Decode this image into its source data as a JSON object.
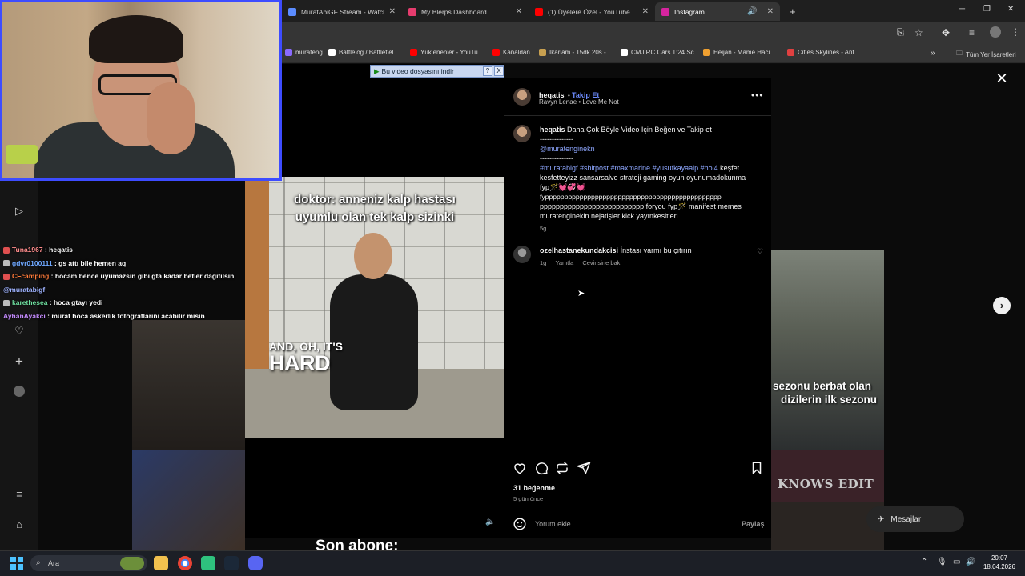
{
  "browser": {
    "tabs": [
      {
        "label": "MuratAbiGF Stream - Watch Liv",
        "color": "#5b8cff"
      },
      {
        "label": "My Blerps Dashboard",
        "color": "#e63c6e"
      },
      {
        "label": "(1) Üyelere Özel - YouTube",
        "color": "#ff0000"
      },
      {
        "label": "Instagram",
        "color": "#d6249f"
      }
    ],
    "bookmarks": [
      {
        "label": "murateng...",
        "color": "#8a6aff"
      },
      {
        "label": "Battlelog / Battlefiel...",
        "color": "#ffffff"
      },
      {
        "label": "Yüklenenler - YouTu...",
        "color": "#ff0000"
      },
      {
        "label": "Kanaldan",
        "color": "#ff0000"
      },
      {
        "label": "Ikariam - 15dk 20s -...",
        "color": "#c8a050"
      },
      {
        "label": "CMJ RC Cars 1:24 Sc...",
        "color": "#ffffff"
      },
      {
        "label": "Heijan - Mame Haci...",
        "color": "#f0a030"
      },
      {
        "label": "Cities Skylines - Ant...",
        "color": "#e04040"
      }
    ],
    "all_bookmarks": "Tüm Yer İşaretleri",
    "new_tab": "+",
    "minimize": "─",
    "maximize": "❐",
    "close": "✕"
  },
  "overlay": {
    "download_bar": "Bu video dosyasını indir",
    "download_help": "?",
    "download_close": "X",
    "chat": [
      {
        "user": "Tuna1967",
        "msg": "heqatis",
        "color": "#ff8c8c"
      },
      {
        "user": "gdvr0100111",
        "msg": "gs attı bile hemen aq",
        "color": "#6fa8ff"
      },
      {
        "user": "CFcamping",
        "msg": "hocam bence uyumazsın gibi gta kadar betler dağıtılsın",
        "color": "#ff7b3a"
      },
      {
        "user": "",
        "msg": "@muratabigf",
        "color": "#9fb3ff"
      },
      {
        "user": "karethesea",
        "msg": "hoca gtayı yedi",
        "color": "#6fe0a0"
      },
      {
        "user": "AyhanAyakci",
        "msg": "murat hoca askerlik fotograflarini acabilir misin",
        "color": "#c58cff"
      }
    ],
    "son_abone": "Son abone:"
  },
  "video": {
    "caption_line1": "doktor: anneniz kalp hastası",
    "caption_line2": "uyumlu olan tek kalp sizinki",
    "caption_small": "AND, OH, IT'S",
    "caption_big": "HARD"
  },
  "post": {
    "username": "heqatis",
    "follow": "Takip Et",
    "audio": "Ravyn Lenae • Love Me Not",
    "caption_user": "heqatis",
    "caption_line1": "Daha Çok Böyle Video İçin Beğen ve Takip et",
    "separator": "--------------",
    "mention": "@muratenginekn",
    "hashtags": "#muratabigf #shitpost #maxmarine #yusufkayaalp #hoi4",
    "caption_rest1": "keşfet",
    "caption_rest2": "kesfetteyizz sansarsalvo strateji gaming oyun oyunumadokunma",
    "caption_rest3": "fyp🪄💓💞💓",
    "caption_rest4": "fypppppppppppppppppppppppppppppppppppppppppppppp",
    "caption_rest5": "pppppppppppppppppppppppppp foryou fyp🪄 manifest memes",
    "caption_rest6": "muratenginekin nejatişler kick yayınkesitleri",
    "caption_time": "5g",
    "comment_user": "ozelhastanekundakcisi",
    "comment_text": "İnstası varmı bu çıtırın",
    "comment_time": "1g",
    "comment_reply": "Yanıtla",
    "comment_translate": "Çevirisine bak",
    "likes": "31 beğenme",
    "date": "5 gün önce",
    "comment_placeholder": "Yorum ekle...",
    "share": "Paylaş"
  },
  "background": {
    "tile_text1": "sezonu berbat olan",
    "tile_text2": "dizilerin ilk sezonu",
    "tile_text3": "KNOWS EDIT",
    "messages": "Mesajlar"
  },
  "taskbar": {
    "search": "Ara",
    "time": "20:07",
    "date": "18.04.2026"
  }
}
